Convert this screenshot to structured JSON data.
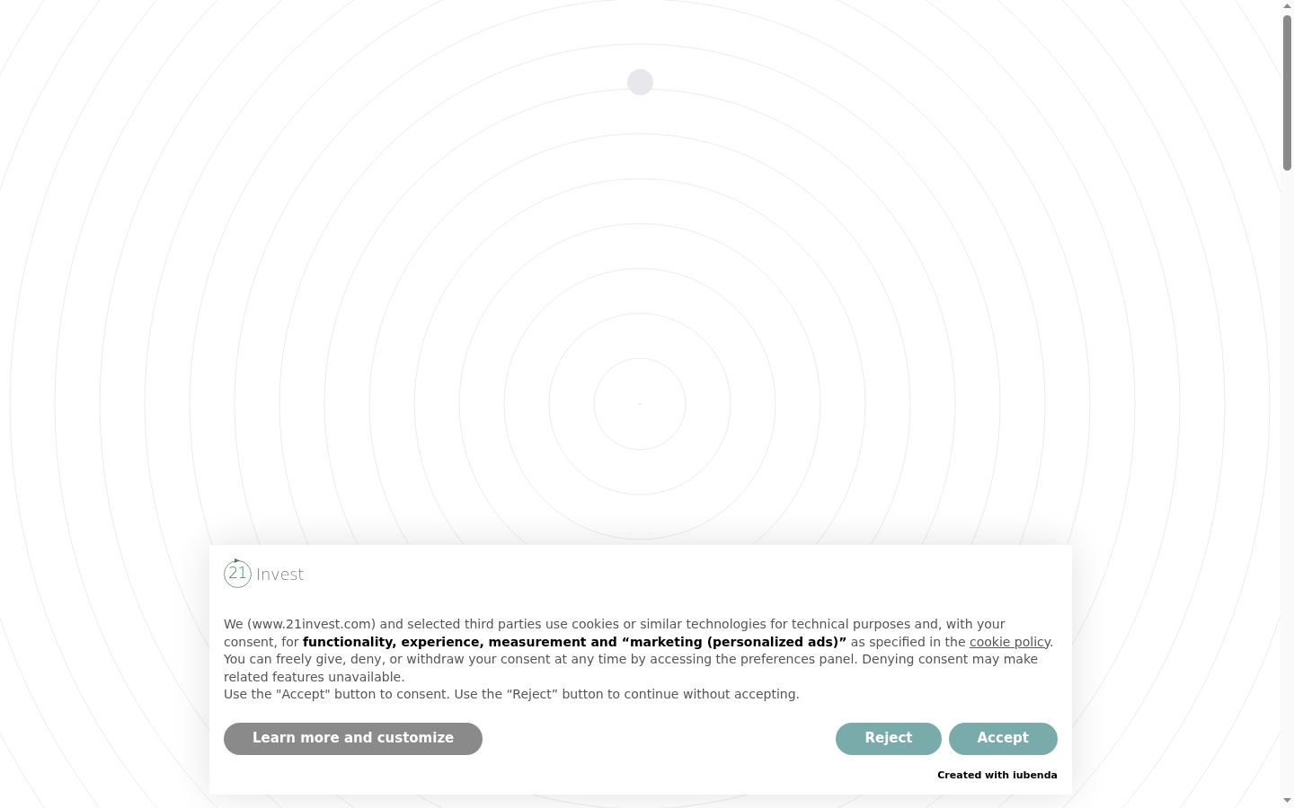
{
  "logo": {
    "number": "21",
    "name": "Invest"
  },
  "notice": [
    {
      "text": "We (www.21invest.com) and selected third parties use cookies or similar technologies for technical purposes and, with your consent, for **functionality, experience, measurement and “marketing (personalized ads)”** as specified in the ",
      "link": "cookie policy",
      "after": "."
    },
    {
      "text": "You can freely give, deny, or withdraw your consent at any time by accessing the preferences panel. Denying consent may make related features unavailable."
    },
    {
      "text": "Use the \"Accept\" button to consent. Use the “Reject” button to continue without accepting."
    }
  ],
  "buttons": [
    {
      "label": "Learn more and customize",
      "kind": "secondary"
    },
    {
      "label": "Reject",
      "kind": "primary"
    },
    {
      "label": "Accept",
      "kind": "primary"
    }
  ],
  "credit": "Created with iubenda"
}
